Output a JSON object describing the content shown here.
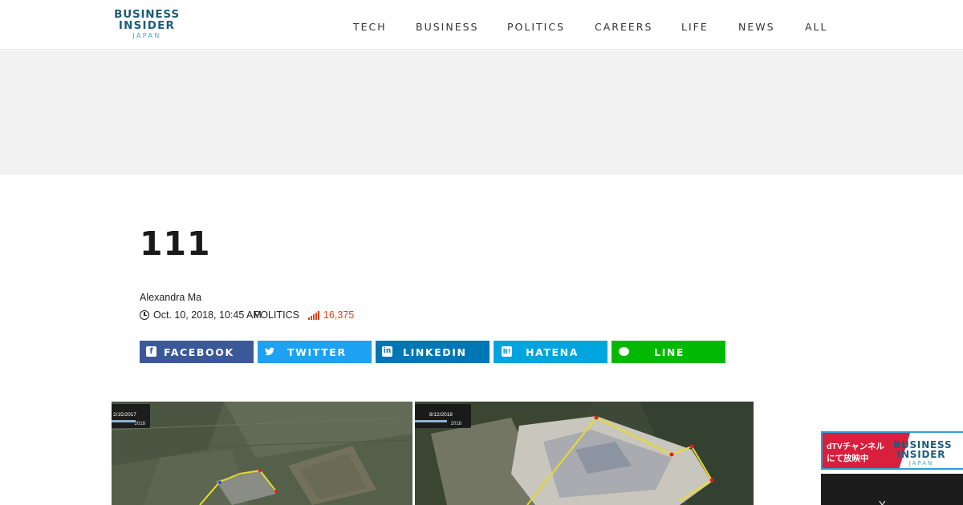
{
  "header": {
    "logo": {
      "line1": "BUSINESS",
      "line2": "INSIDER",
      "line3": "JAPAN"
    },
    "nav": [
      "TECH",
      "BUSINESS",
      "POLITICS",
      "CAREERS",
      "LIFE",
      "NEWS",
      "ALL"
    ]
  },
  "article": {
    "title": "111",
    "author": "Alexandra Ma",
    "date": "Oct. 10, 2018, 10:45 AM",
    "category": "POLITICS",
    "views": "16,375"
  },
  "share": [
    {
      "label": "FACEBOOK",
      "icon": "facebook-icon",
      "color": "#3b5998"
    },
    {
      "label": "TWITTER",
      "icon": "twitter-icon",
      "color": "#1da1f2"
    },
    {
      "label": "LINKEDIN",
      "icon": "linkedin-icon",
      "color": "#0077b5"
    },
    {
      "label": "HATENA",
      "icon": "hatena-icon",
      "color": "#00a4de"
    },
    {
      "label": "LINE",
      "icon": "line-icon",
      "color": "#00b900"
    }
  ],
  "images": {
    "left_date": "2/15/2017",
    "left_year": "2018",
    "right_date": "8/12/2018",
    "right_year": "2018"
  },
  "ad": {
    "red_line1": "dTVチャンネル",
    "red_line2": "にて放映中",
    "logo_line1": "BUSINESS",
    "logo_line2": "INSIDER",
    "logo_line3": "JAPAN"
  },
  "video": {
    "text": "Y..."
  }
}
